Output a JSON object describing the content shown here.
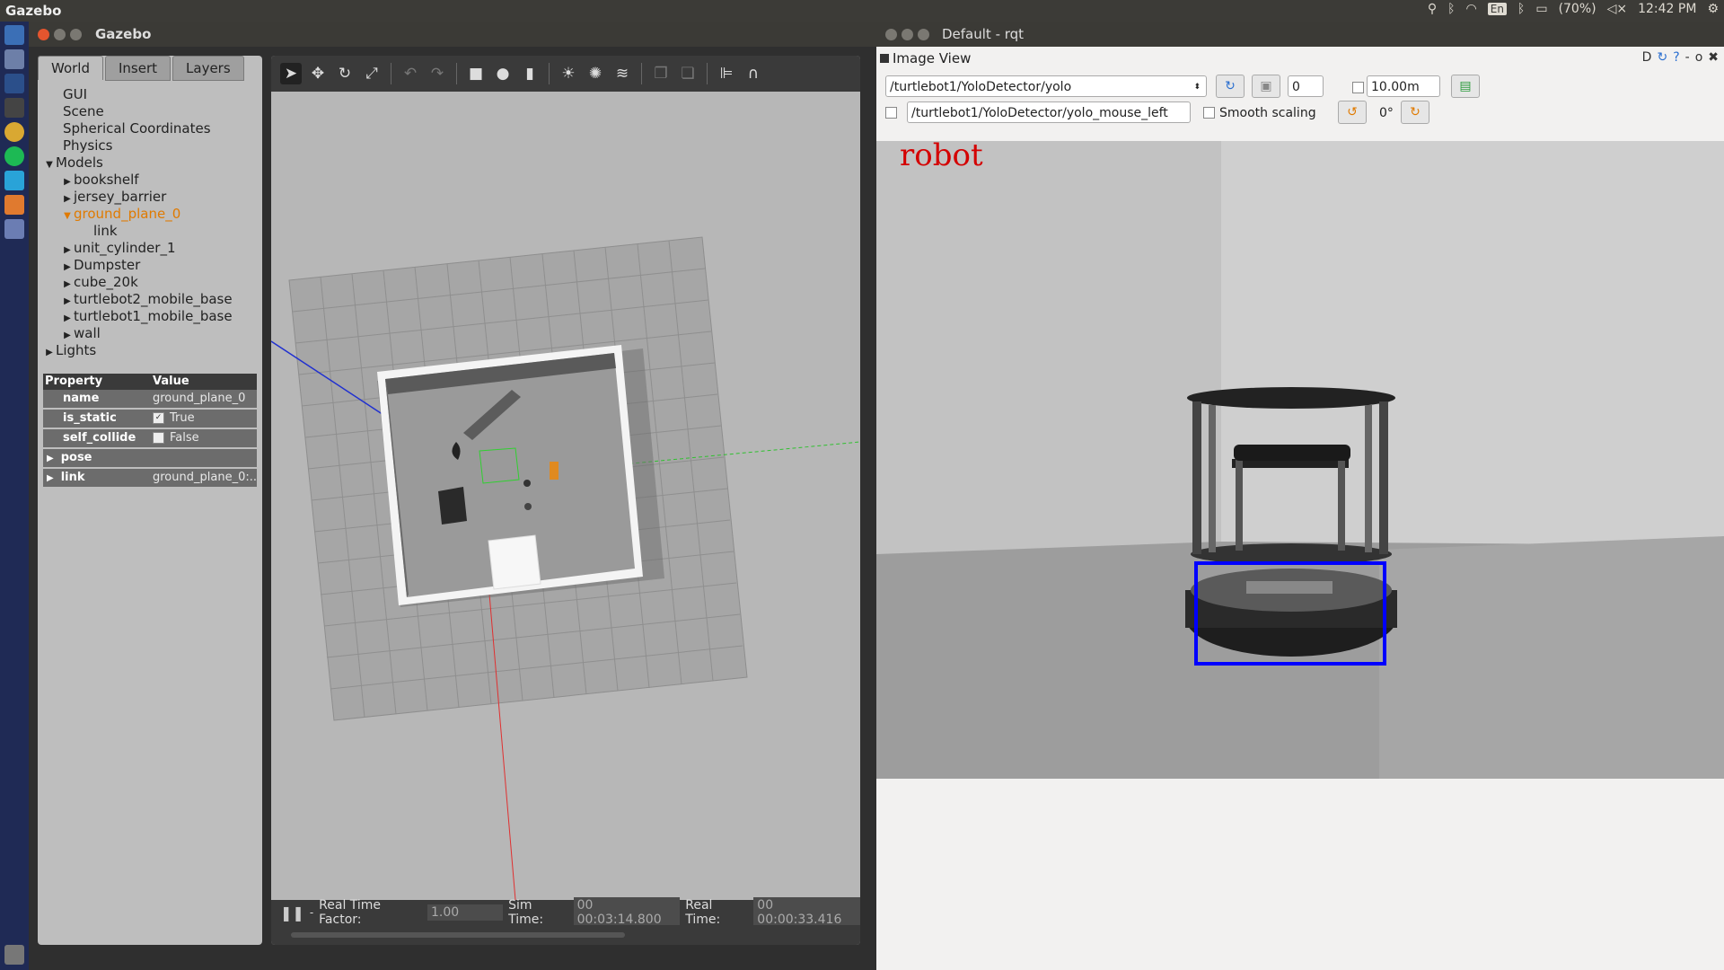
{
  "top_panel": {
    "app_name": "Gazebo",
    "battery": "(70%)",
    "clock": "12:42 PM",
    "lang": "En"
  },
  "gazebo": {
    "title": "Gazebo",
    "tabs": [
      "World",
      "Insert",
      "Layers"
    ],
    "tree": {
      "gui": "GUI",
      "scene": "Scene",
      "spherical": "Spherical Coordinates",
      "physics": "Physics",
      "models": "Models",
      "model_items": [
        "bookshelf",
        "jersey_barrier",
        "ground_plane_0",
        "link",
        "unit_cylinder_1",
        "Dumpster",
        "cube_20k",
        "turtlebot2_mobile_base",
        "turtlebot1_mobile_base",
        "wall"
      ],
      "lights": "Lights"
    },
    "properties": {
      "header_property": "Property",
      "header_value": "Value",
      "rows": [
        {
          "key": "name",
          "value": "ground_plane_0"
        },
        {
          "key": "is_static",
          "value": "True"
        },
        {
          "key": "self_collide",
          "value": "False"
        },
        {
          "key": "pose",
          "value": ""
        },
        {
          "key": "link",
          "value": "ground_plane_0:..."
        }
      ]
    },
    "status": {
      "rtf_label": "Real Time Factor:",
      "rtf_value": "1.00",
      "sim_label": "Sim Time:",
      "sim_value": "00 00:03:14.800",
      "real_label": "Real Time:",
      "real_value": "00 00:00:33.416"
    },
    "toolbar_icons": [
      "select-icon",
      "translate-icon",
      "rotate-icon",
      "scale-icon",
      "undo-icon",
      "redo-icon",
      "box-icon",
      "sphere-icon",
      "cylinder-icon",
      "point-light-icon",
      "spot-light-icon",
      "directional-light-icon",
      "copy-icon",
      "paste-icon",
      "align-icon",
      "snap-icon"
    ]
  },
  "rqt": {
    "title": "Default - rqt",
    "plugin_title": "Image View",
    "plugin_btns": "D",
    "topic": "/turtlebot1/YoloDetector/yolo",
    "spin_value": "0",
    "range_value": "10.00m",
    "mouse_topic": "/turtlebot1/YoloDetector/yolo_mouse_left",
    "smooth_label": "Smooth scaling",
    "rotation": "0°",
    "detection_label": "robot"
  },
  "colors": {
    "selected_tree": "#e07a00",
    "bbox": "#0000ff",
    "detection_text": "#d40000"
  }
}
